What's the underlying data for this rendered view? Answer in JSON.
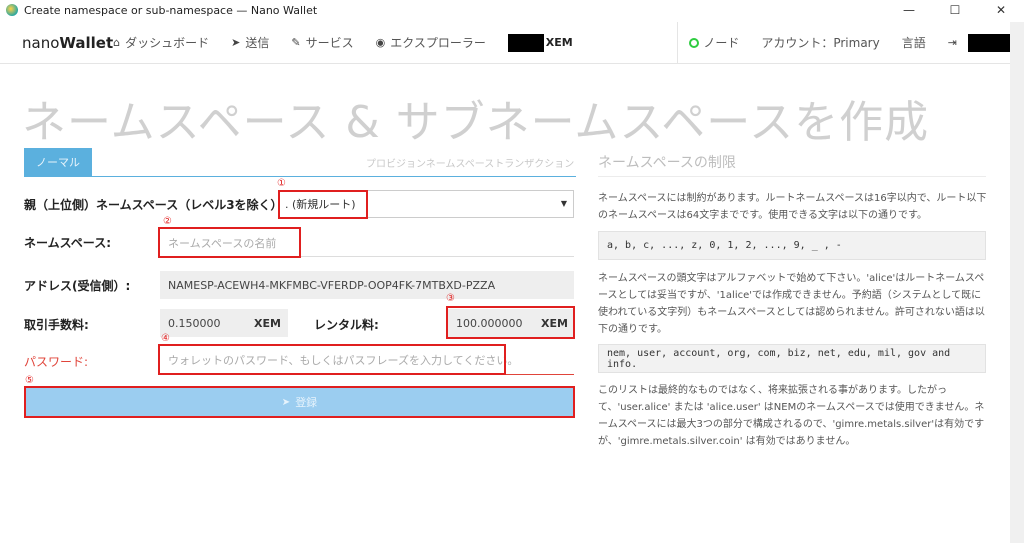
{
  "window": {
    "title": "Create namespace or sub-namespace — Nano Wallet",
    "min": "—",
    "max": "☐",
    "close": "✕"
  },
  "nav": {
    "brand_light": "nano",
    "brand_bold": "Wallet",
    "dashboard": "ダッシュボード",
    "send": "送信",
    "services": "サービス",
    "explorer": "エクスプローラー",
    "balance_unit": "XEM",
    "node": "ノード",
    "account": "アカウント：Primary",
    "language": "言語"
  },
  "page": {
    "title": "ネームスペース & サブネームスペースを作成"
  },
  "tabs": {
    "normal": "ノーマル",
    "provision": "プロビジョンネームスペーストランザクション"
  },
  "form": {
    "parent_label": "親（上位側）ネームスペース（レベル3を除く）:",
    "parent_value": ". (新規ルート)",
    "namespace_label": "ネームスペース:",
    "namespace_placeholder": "ネームスペースの名前",
    "address_label": "アドレス(受信側）:",
    "address_value": "NAMESP-ACEWH4-MKFMBC-VFERDP-OOP4FK-7MTBXD-PZZA",
    "fee_label": "取引手数料:",
    "fee_value": "0.150000",
    "fee_unit": "XEM",
    "rental_label": "レンタル料:",
    "rental_value": "100.000000",
    "rental_unit": "XEM",
    "password_label": "パスワード:",
    "password_placeholder": "ウォレットのパスワード、もしくはパスフレーズを入力してください。",
    "register_label": "登録"
  },
  "markers": {
    "m1": "①",
    "m2": "②",
    "m3": "③",
    "m4": "④",
    "m5": "⑤"
  },
  "side": {
    "title": "ネームスペースの制限",
    "p1": "ネームスペースには制約があります。ルートネームスペースは16字以内で、ルート以下のネームスペースは64文字までです。使用できる文字は以下の通りです。",
    "chars": "a, b, c, ..., z, 0, 1, 2, ..., 9, _ , -",
    "p2": "ネームスペースの頭文字はアルファベットで始めて下さい。'alice'はルートネームスペースとしては妥当ですが、'1alice'では作成できません。予約語（システムとして既に使われている文字列）もネームスペースとしては認められません。許可されない語は以下の通りです。",
    "reserved": "nem, user, account, org, com, biz, net, edu, mil, gov and info.",
    "p3": "このリストは最終的なものではなく、将来拡張される事があります。したがって、'user.alice' または 'alice.user' はNEMのネームスペースでは使用できません。ネームスペースには最大3つの部分で構成されるので、'gimre.metals.silver'は有効ですが、'gimre.metals.silver.coin' は有効ではありません。"
  },
  "colors": {
    "accent": "#5bb0de",
    "button": "#9bcdf0",
    "marker": "#e01f1f",
    "node": "#2ecc40"
  }
}
